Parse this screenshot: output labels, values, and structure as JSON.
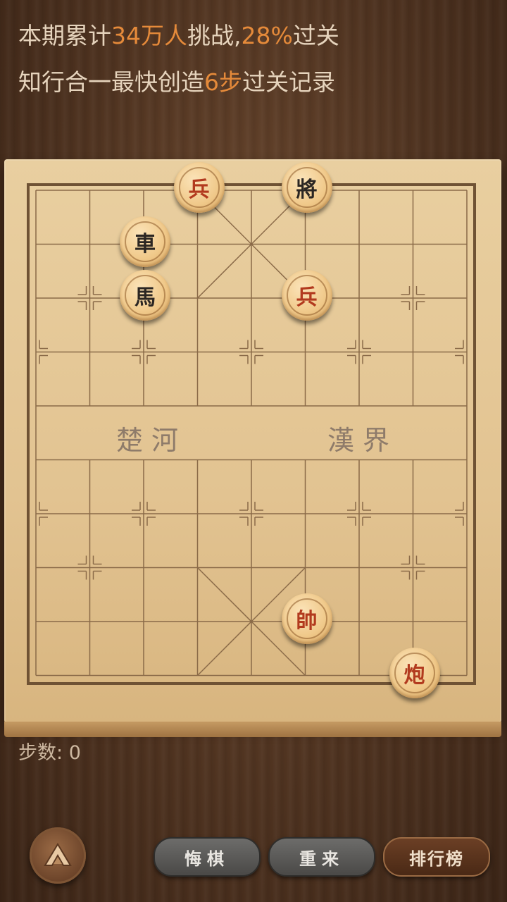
{
  "header": {
    "line1": {
      "prefix": "本期累计",
      "count": "34万人",
      "mid": "挑战,",
      "rate": "28%",
      "suffix": "过关"
    },
    "line2": {
      "prefix": "知行合一最快创造",
      "steps": "6步",
      "suffix": "过关记录"
    }
  },
  "board": {
    "river_left": "楚 河",
    "river_right": "漢 界"
  },
  "pieces": [
    {
      "id": "red-soldier-top",
      "char": "兵",
      "side": "red",
      "file": 3,
      "rank": 0
    },
    {
      "id": "black-general",
      "char": "將",
      "side": "black",
      "file": 5,
      "rank": 0
    },
    {
      "id": "black-chariot",
      "char": "車",
      "side": "black",
      "file": 2,
      "rank": 1
    },
    {
      "id": "black-horse",
      "char": "馬",
      "side": "black",
      "file": 2,
      "rank": 2
    },
    {
      "id": "red-soldier-mid",
      "char": "兵",
      "side": "red",
      "file": 5,
      "rank": 2
    },
    {
      "id": "red-general",
      "char": "帥",
      "side": "red",
      "file": 5,
      "rank": 8
    },
    {
      "id": "red-cannon",
      "char": "炮",
      "side": "red",
      "file": 7,
      "rank": 9
    }
  ],
  "status": {
    "steps_label": "步数:",
    "steps_value": "0"
  },
  "buttons": {
    "undo": "悔棋",
    "restart": "重来",
    "leaderboard": "排行榜"
  },
  "icons": {
    "home": "home-icon"
  },
  "colors": {
    "highlight": "#e58a3a",
    "red_piece": "#b23a1e",
    "black_piece": "#2b2622"
  }
}
